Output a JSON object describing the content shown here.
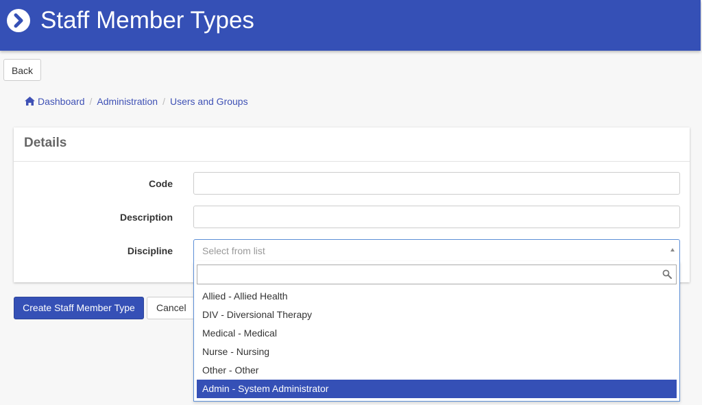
{
  "header": {
    "title": "Staff Member Types",
    "icon": "chevron-right-circle-icon",
    "color": "#3550b6"
  },
  "back_button": "Back",
  "breadcrumb": {
    "home_icon": "home-icon",
    "items": [
      "Dashboard",
      "Administration",
      "Users and Groups"
    ],
    "separator": "/"
  },
  "details": {
    "title": "Details",
    "fields": {
      "code": {
        "label": "Code",
        "value": ""
      },
      "description": {
        "label": "Description",
        "value": ""
      },
      "discipline": {
        "label": "Discipline",
        "placeholder": "Select from list"
      }
    }
  },
  "dropdown": {
    "search_value": "",
    "options": [
      "Allied - Allied Health",
      "DIV - Diversional Therapy",
      "Medical - Medical",
      "Nurse - Nursing",
      "Other - Other",
      "Admin - System Administrator"
    ],
    "highlighted": "Admin - System Administrator"
  },
  "actions": {
    "create": "Create Staff Member Type",
    "cancel": "Cancel"
  }
}
